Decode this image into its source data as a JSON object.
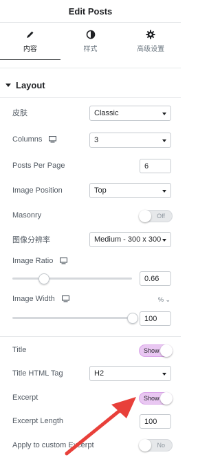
{
  "header": {
    "title": "Edit Posts"
  },
  "tabs": [
    {
      "label": "内容",
      "icon": "pencil-icon",
      "active": true
    },
    {
      "label": "样式",
      "icon": "half-circle-icon",
      "active": false
    },
    {
      "label": "高级设置",
      "icon": "gear-icon",
      "active": false
    }
  ],
  "section": {
    "title": "Layout"
  },
  "fields": {
    "skin": {
      "label": "皮肤",
      "value": "Classic"
    },
    "columns": {
      "label": "Columns",
      "value": "3"
    },
    "posts_per_page": {
      "label": "Posts Per Page",
      "value": "6"
    },
    "image_position": {
      "label": "Image Position",
      "value": "Top"
    },
    "masonry": {
      "label": "Masonry",
      "state": "Off"
    },
    "image_resolution": {
      "label": "图像分辨率",
      "value": "Medium - 300 x 300"
    },
    "image_ratio": {
      "label": "Image Ratio",
      "value": "0.66",
      "fraction": 0.26
    },
    "image_width": {
      "label": "Image Width",
      "unit": "%",
      "value": "100",
      "fraction": 1.0
    },
    "title": {
      "label": "Title",
      "state": "Show"
    },
    "title_html_tag": {
      "label": "Title HTML Tag",
      "value": "H2"
    },
    "excerpt": {
      "label": "Excerpt",
      "state": "Show"
    },
    "excerpt_length": {
      "label": "Excerpt Length",
      "value": "100"
    },
    "apply_custom_excerpt": {
      "label": "Apply to custom Excerpt",
      "state": "No"
    }
  },
  "colors": {
    "toggle_on": "#e9c7f2",
    "annotation_arrow": "#e8403a"
  }
}
